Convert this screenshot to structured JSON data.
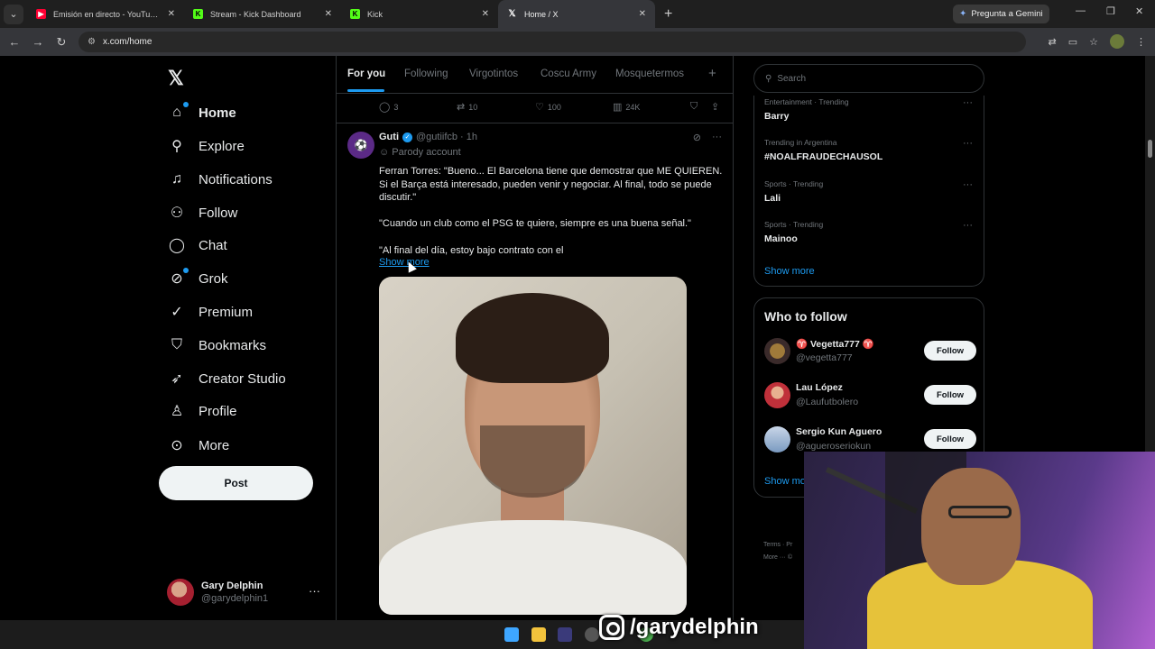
{
  "browser": {
    "tabs": [
      {
        "label": "Emisión en directo - YouTube S",
        "favicon_color": "#ff0033"
      },
      {
        "label": "Stream - Kick Dashboard",
        "favicon_color": "#53fc18"
      },
      {
        "label": "Kick",
        "favicon_color": "#53fc18"
      },
      {
        "label": "Home / X",
        "favicon_color": "#ffffff"
      }
    ],
    "gemini_label": "Pregunta a Gemini",
    "url": "x.com/home"
  },
  "nav": {
    "items": [
      {
        "label": "Home",
        "icon": "home-icon"
      },
      {
        "label": "Explore",
        "icon": "search-icon"
      },
      {
        "label": "Notifications",
        "icon": "bell-icon"
      },
      {
        "label": "Follow",
        "icon": "add-person-icon"
      },
      {
        "label": "Chat",
        "icon": "chat-icon"
      },
      {
        "label": "Grok",
        "icon": "grok-icon"
      },
      {
        "label": "Premium",
        "icon": "verified-badge-icon"
      },
      {
        "label": "Bookmarks",
        "icon": "bookmark-icon"
      },
      {
        "label": "Creator Studio",
        "icon": "rocket-icon"
      },
      {
        "label": "Profile",
        "icon": "person-icon"
      },
      {
        "label": "More",
        "icon": "more-circle-icon"
      }
    ],
    "post_label": "Post",
    "account": {
      "name": "Gary Delphin",
      "handle": "@garydelphin1"
    }
  },
  "feed": {
    "tabs": [
      "For you",
      "Following",
      "Virgotintos",
      "Coscu Army",
      "Mosquetermos"
    ],
    "prev_actions": {
      "replies": "3",
      "reposts": "10",
      "likes": "100",
      "views": "24K"
    },
    "post": {
      "name": "Guti",
      "handle": "@gutiifcb",
      "time": "· 1h",
      "parody": "Parody account",
      "paragraph1": "Ferran Torres: \"Bueno... El Barcelona tiene que demostrar que ME QUIEREN. Si el Barça está interesado, pueden venir y negociar. Al final, todo se puede discutir.\"",
      "paragraph2": "\"Cuando un club como el PSG te quiere, siempre es una buena señal.\"",
      "paragraph3": "\"Al final del día, estoy bajo contrato con el",
      "show_more": "Show more"
    }
  },
  "sidebar": {
    "search_placeholder": "Search",
    "trends": [
      {
        "meta": "Entertainment · Trending",
        "name": "Barry"
      },
      {
        "meta": "Trending in Argentina",
        "name": "#NOALFRAUDECHAUSOL"
      },
      {
        "meta": "Sports · Trending",
        "name": "Lali"
      },
      {
        "meta": "Sports · Trending",
        "name": "Mainoo"
      }
    ],
    "trends_show_more": "Show more",
    "who_to_follow": {
      "title": "Who to follow",
      "accounts": [
        {
          "name": "♈ Vegetta777 ♈",
          "handle": "@vegetta777",
          "button": "Follow"
        },
        {
          "name": "Lau López",
          "handle": "@Laufutbolero",
          "button": "Follow"
        },
        {
          "name": "Sergio Kun Aguero",
          "handle": "@agueroseriokun",
          "button": "Follow"
        }
      ],
      "show_more": "Show mo"
    },
    "footer": {
      "line1": "Terms · Pr",
      "line2": "More ··· ©"
    }
  },
  "overlay": {
    "watermark": "/garydelphin"
  }
}
